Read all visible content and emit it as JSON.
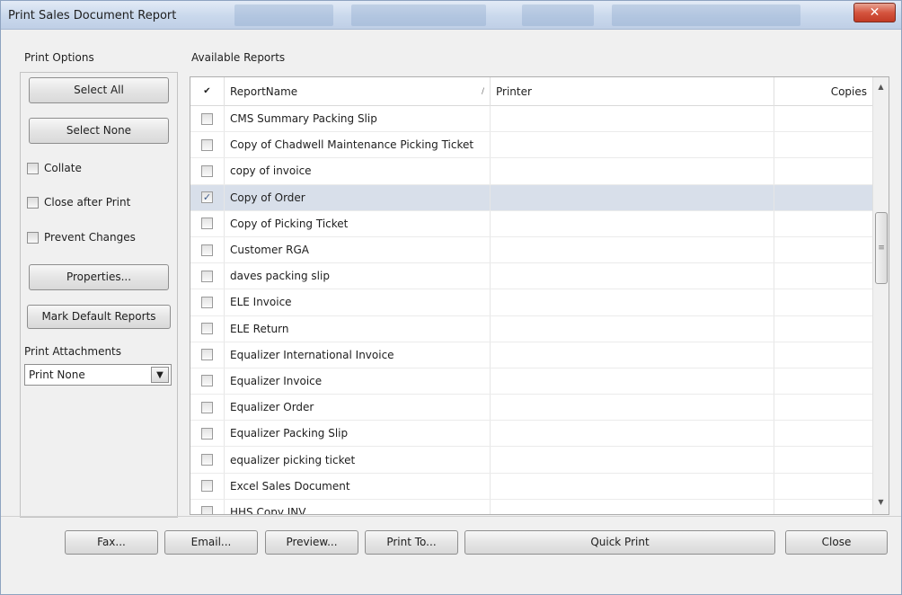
{
  "window": {
    "title": "Print Sales Document Report",
    "close_glyph": "✕"
  },
  "left": {
    "group_label": "Print Options",
    "select_all": "Select All",
    "select_none": "Select None",
    "collate": "Collate",
    "close_after_print": "Close after Print",
    "prevent_changes": "Prevent Changes",
    "properties": "Properties...",
    "mark_default": "Mark Default Reports",
    "attachments_label": "Print Attachments",
    "attachments_value": "Print None"
  },
  "grid": {
    "group_label": "Available Reports",
    "header": {
      "check": "✔",
      "name": "ReportName",
      "sort_glyph": "/",
      "printer": "Printer",
      "copies": "Copies"
    },
    "rows": [
      {
        "name": "CMS Summary Packing Slip",
        "checked": false
      },
      {
        "name": "Copy of Chadwell Maintenance Picking Ticket",
        "checked": false
      },
      {
        "name": "copy of invoice",
        "checked": false
      },
      {
        "name": "Copy of Order",
        "checked": true
      },
      {
        "name": "Copy of Picking Ticket",
        "checked": false
      },
      {
        "name": "Customer RGA",
        "checked": false
      },
      {
        "name": "daves packing slip",
        "checked": false
      },
      {
        "name": "ELE Invoice",
        "checked": false
      },
      {
        "name": "ELE Return",
        "checked": false
      },
      {
        "name": "Equalizer International Invoice",
        "checked": false
      },
      {
        "name": "Equalizer Invoice",
        "checked": false
      },
      {
        "name": "Equalizer Order",
        "checked": false
      },
      {
        "name": "Equalizer Packing Slip",
        "checked": false
      },
      {
        "name": "equalizer picking ticket",
        "checked": false
      },
      {
        "name": "Excel Sales Document",
        "checked": false
      },
      {
        "name": "HHS Copy INV",
        "checked": false
      }
    ]
  },
  "buttons": {
    "fax": "Fax...",
    "email": "Email...",
    "preview": "Preview...",
    "print_to": "Print To...",
    "quick_print": "Quick Print",
    "close": "Close"
  },
  "colors": {
    "selected_row": "#d8dfea",
    "close_button": "#c23a25",
    "titlebar": "#c9d8ec"
  }
}
